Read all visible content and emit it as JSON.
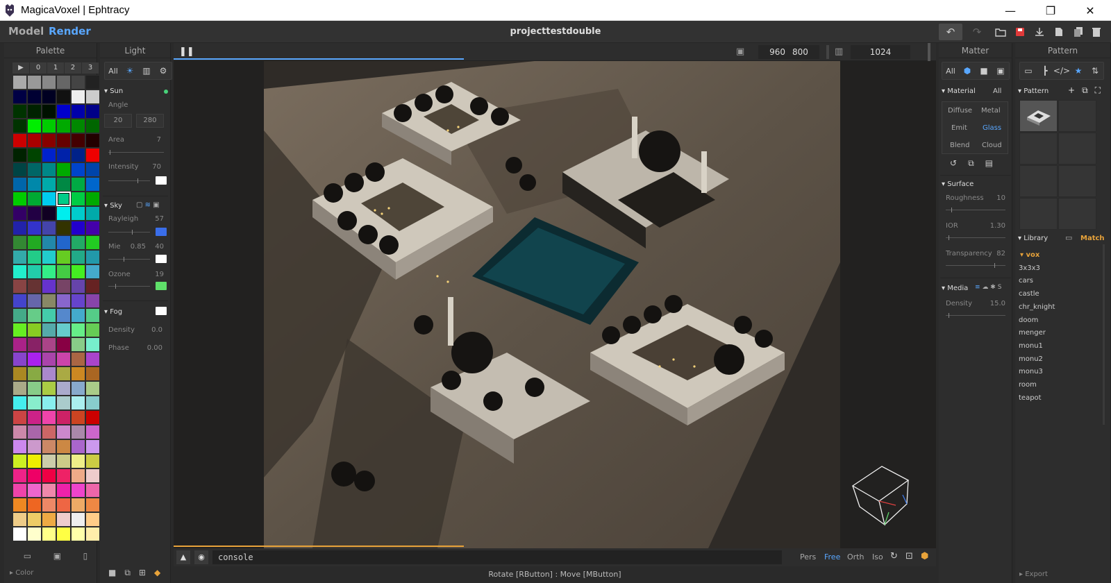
{
  "window": {
    "title": "MagicaVoxel | Ephtracy"
  },
  "menubar": {
    "model_tab": "Model",
    "render_tab": "Render",
    "project_name": "projecttestdouble"
  },
  "palette": {
    "title": "Palette",
    "tabs": [
      "▶",
      "0",
      "1",
      "2",
      "3"
    ],
    "footer_label": "Color",
    "colors": [
      "#aaaaaa",
      "#999999",
      "#888888",
      "#666666",
      "#444444",
      "#222222",
      "#000044",
      "#000033",
      "#000022",
      "#111111",
      "#eeeeee",
      "#cccccc",
      "#003300",
      "#002200",
      "#001100",
      "#0000cc",
      "#0000aa",
      "#000088",
      "#003300",
      "#00ee00",
      "#00cc00",
      "#00aa00",
      "#008800",
      "#006600",
      "#cc0000",
      "#aa0000",
      "#880000",
      "#660000",
      "#440000",
      "#220000",
      "#002200",
      "#004400",
      "#0022cc",
      "#0022aa",
      "#002288",
      "#ee0000",
      "#004444",
      "#006666",
      "#008888",
      "#00aa00",
      "#0044cc",
      "#0044aa",
      "#0066aa",
      "#0088aa",
      "#00aaaa",
      "#008844",
      "#00aa44",
      "#0066cc",
      "#00cc00",
      "#00aa33",
      "#00ccee",
      "#00cc88",
      "#00cc44",
      "#00aa00",
      "#330066",
      "#220044",
      "#110022",
      "#00eeee",
      "#00cccc",
      "#00aaaa",
      "#2222aa",
      "#3333cc",
      "#4444aa",
      "#333300",
      "#2200cc",
      "#4400aa",
      "#338833",
      "#22aa22",
      "#2288aa",
      "#2266cc",
      "#22aa66",
      "#22cc22",
      "#33aaaa",
      "#22cc88",
      "#22cccc",
      "#66cc22",
      "#22aa88",
      "#2299aa",
      "#22eecc",
      "#22ccaa",
      "#33ee88",
      "#44cc44",
      "#44ee22",
      "#44aacc",
      "#884444",
      "#663333",
      "#6633cc",
      "#774466",
      "#6644aa",
      "#662222",
      "#4444cc",
      "#6666aa",
      "#888866",
      "#8866cc",
      "#6644cc",
      "#8844aa",
      "#44aa88",
      "#66cc88",
      "#44ccaa",
      "#5588cc",
      "#44aacc",
      "#55cc88",
      "#66ee22",
      "#88cc22",
      "#55aaaa",
      "#66cccc",
      "#66ee88",
      "#66cc55",
      "#aa2288",
      "#882266",
      "#aa4488",
      "#880044",
      "#88cc88",
      "#77eecc",
      "#8844cc",
      "#aa22ee",
      "#aa44aa",
      "#cc44aa",
      "#aa6644",
      "#aa44cc",
      "#aa8822",
      "#88aa44",
      "#aa88cc",
      "#aaaa44",
      "#cc8822",
      "#aa6622",
      "#aaaa88",
      "#88cc88",
      "#aacc44",
      "#aaaacc",
      "#88aacc",
      "#aacc88",
      "#44eeee",
      "#88eecc",
      "#88eeee",
      "#aacccc",
      "#aaeeee",
      "#88cccc",
      "#cc4444",
      "#cc2288",
      "#ee44aa",
      "#cc2266",
      "#cc4422",
      "#cc0000",
      "#cc88aa",
      "#aa66aa",
      "#cc6666",
      "#cc88cc",
      "#aa88aa",
      "#cc66cc",
      "#cc88ee",
      "#cc99cc",
      "#cc8866",
      "#cc8844",
      "#aa66cc",
      "#cc99ee",
      "#ccee22",
      "#eeee00",
      "#ccccaa",
      "#cccc88",
      "#eeee88",
      "#cccc44",
      "#ee2288",
      "#ee0066",
      "#ee0044",
      "#ee2266",
      "#eeaa88",
      "#eecccc",
      "#ee44aa",
      "#ee66cc",
      "#ee88aa",
      "#ee22aa",
      "#ee44cc",
      "#ee66aa",
      "#ee8822",
      "#ee6622",
      "#ee8866",
      "#ee6644",
      "#eeaa66",
      "#ee8844",
      "#eecc88",
      "#eecc66",
      "#eeaa44",
      "#eecccc",
      "#eeeeee",
      "#ffcc88",
      "#ffffff",
      "#ffffcc",
      "#ffff88",
      "#ffff44",
      "#ffffaa",
      "#ffeeaa"
    ]
  },
  "light": {
    "title": "Light",
    "tab_all": "All",
    "sun": {
      "label": "Sun",
      "angle_label": "Angle",
      "angle1": "20",
      "angle2": "280",
      "area_label": "Area",
      "area": "7",
      "intensity_label": "Intensity",
      "intensity": "70"
    },
    "sky": {
      "label": "Sky",
      "rayleigh_label": "Rayleigh",
      "rayleigh": "57",
      "mie_label": "Mie",
      "mie_a": "0.85",
      "mie_b": "40",
      "ozone_label": "Ozone",
      "ozone": "19"
    },
    "fog": {
      "label": "Fog",
      "density_label": "Density",
      "density": "0.0",
      "phase_label": "Phase",
      "phase": "0.00"
    }
  },
  "render": {
    "width": "960",
    "height": "800",
    "samples": "1024",
    "console": "console"
  },
  "camera": {
    "pers": "Pers",
    "free": "Free",
    "orth": "Orth",
    "iso": "Iso"
  },
  "status": {
    "hint": "Rotate [RButton] : Move [MButton]"
  },
  "matter": {
    "title": "Matter",
    "tab_all": "All",
    "material_label": "Material",
    "material_all": "All",
    "materials": [
      "Diffuse",
      "Metal",
      "Emit",
      "Glass",
      "Blend",
      "Cloud"
    ],
    "surface_label": "Surface",
    "roughness_label": "Roughness",
    "roughness": "10",
    "ior_label": "IOR",
    "ior": "1.30",
    "transparency_label": "Transparency",
    "transparency": "82",
    "media_label": "Media",
    "media_s": "S",
    "density_label": "Density",
    "density": "15.0"
  },
  "pattern": {
    "title": "Pattern",
    "pattern_label": "Pattern",
    "library_label": "Library",
    "match_label": "Match",
    "export_label": "Export",
    "items": [
      "vox",
      "3x3x3",
      "cars",
      "castle",
      "chr_knight",
      "doom",
      "menger",
      "monu1",
      "monu2",
      "monu3",
      "room",
      "teapot"
    ]
  },
  "colors": {
    "accent_blue": "#59a7ff",
    "accent_orange": "#e8a33a",
    "selected_material": "#59a7ff",
    "sun_dot": "#48d27a"
  }
}
